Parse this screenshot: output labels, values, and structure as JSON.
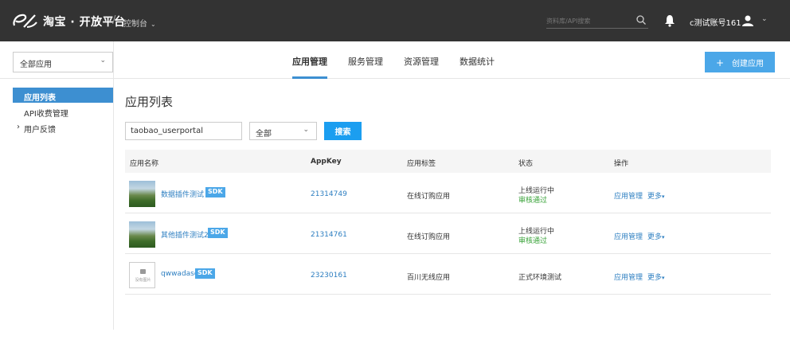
{
  "header": {
    "platform_title": "淘宝 · 开放平台",
    "separator": "/",
    "console_label": "控制台",
    "search_placeholder": "资料库/API搜索",
    "account_name": "c测试账号161"
  },
  "subnav": {
    "app_select_value": "全部应用",
    "tabs": [
      {
        "label": "应用管理",
        "active": true
      },
      {
        "label": "服务管理",
        "active": false
      },
      {
        "label": "资源管理",
        "active": false
      },
      {
        "label": "数据统计",
        "active": false
      }
    ],
    "create_button": "创建应用"
  },
  "sidebar": {
    "items": [
      {
        "label": "应用列表",
        "active": true
      },
      {
        "label": "API收费管理",
        "active": false
      },
      {
        "label": "用户反馈",
        "active": false,
        "expandable": true
      }
    ]
  },
  "main": {
    "title": "应用列表",
    "search_value": "taobao_userportal",
    "status_filter": "全部",
    "search_button": "搜索",
    "columns": [
      "应用名称",
      "AppKey",
      "应用标签",
      "状态",
      "操作"
    ],
    "rows": [
      {
        "thumb": "landscape",
        "name": "数据插件测试",
        "badge": "SDK",
        "appkey": "21314749",
        "tag": "在线订购应用",
        "status": "上线运行中",
        "review": "审核通过",
        "op_manage": "应用管理",
        "op_more": "更多"
      },
      {
        "thumb": "landscape",
        "name": "其他插件测试2",
        "badge": "SDK",
        "appkey": "21314761",
        "tag": "在线订购应用",
        "status": "上线运行中",
        "review": "审核通过",
        "op_manage": "应用管理",
        "op_more": "更多"
      },
      {
        "thumb": "placeholder",
        "thumb_text": "没有图片",
        "name": "qwwadasd",
        "badge": "SDK",
        "appkey": "23230161",
        "tag": "百川无线应用",
        "status": "正式环境测试",
        "op_manage": "应用管理",
        "op_more": "更多"
      }
    ]
  },
  "colors": {
    "topbar": "#333333",
    "accent": "#3d8fd1",
    "button": "#1b9ef0",
    "link": "#2e7fc1",
    "success": "#3aa33a"
  }
}
